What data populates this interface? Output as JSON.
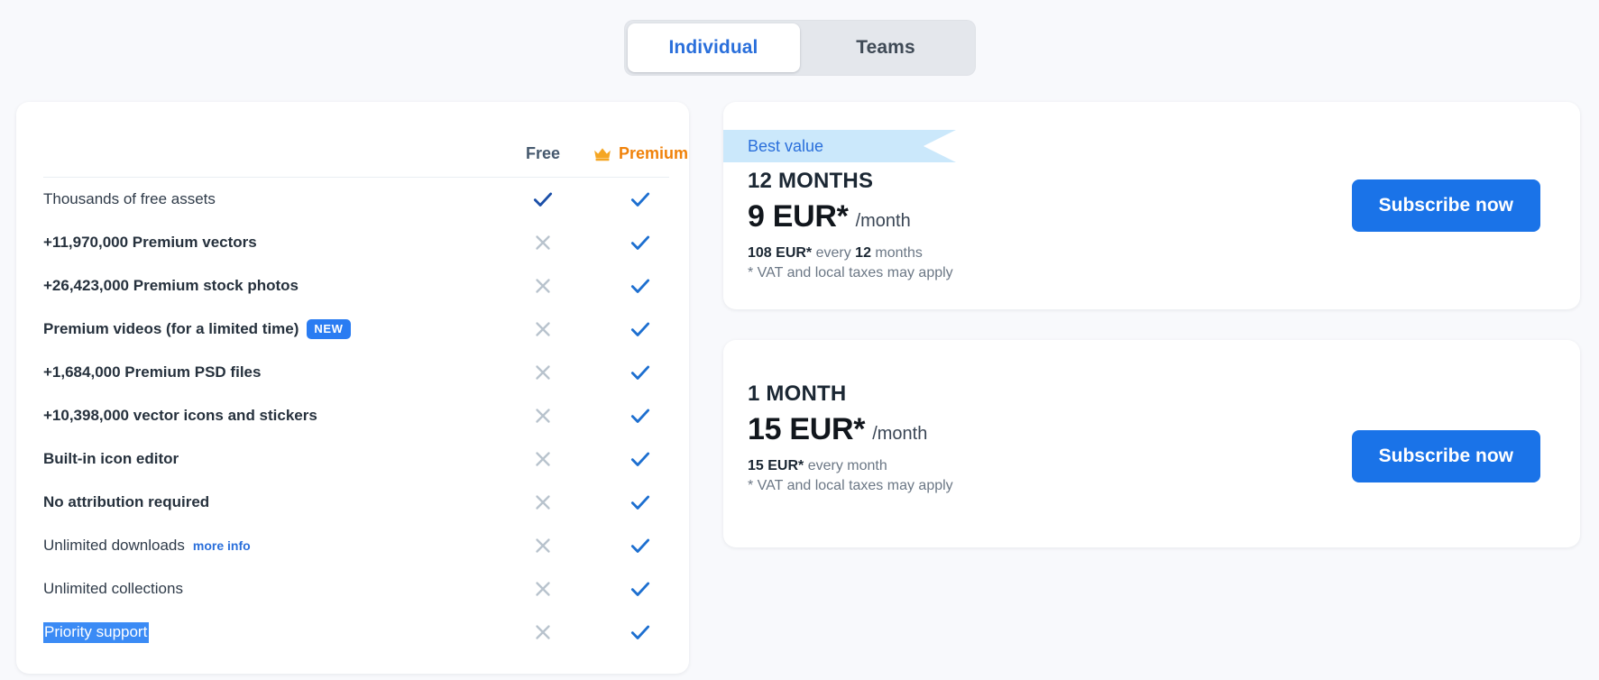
{
  "tabs": {
    "individual": "Individual",
    "teams": "Teams"
  },
  "features": {
    "columns": {
      "free": "Free",
      "premium": "Premium",
      "premium_icon": "crown-icon"
    },
    "rows": [
      {
        "label": "Thousands of free assets",
        "bold": false,
        "free": "check",
        "premium": "check"
      },
      {
        "label": "+11,970,000 Premium vectors",
        "bold": true,
        "free": "cross",
        "premium": "check"
      },
      {
        "label": "+26,423,000 Premium stock photos",
        "bold": true,
        "free": "cross",
        "premium": "check"
      },
      {
        "label": "Premium videos (for a limited time)",
        "bold": true,
        "badge": "NEW",
        "free": "cross",
        "premium": "check"
      },
      {
        "label": "+1,684,000 Premium PSD files",
        "bold": true,
        "free": "cross",
        "premium": "check"
      },
      {
        "label": "+10,398,000 vector icons and stickers",
        "bold": true,
        "free": "cross",
        "premium": "check"
      },
      {
        "label": "Built-in icon editor",
        "bold": true,
        "free": "cross",
        "premium": "check"
      },
      {
        "label": "No attribution required",
        "bold": true,
        "free": "cross",
        "premium": "check"
      },
      {
        "label": "Unlimited downloads",
        "bold": false,
        "link": "more info",
        "free": "cross",
        "premium": "check"
      },
      {
        "label": "Unlimited collections",
        "bold": false,
        "free": "cross",
        "premium": "check"
      },
      {
        "label": "Priority support",
        "bold": false,
        "selected": true,
        "free": "cross",
        "premium": "check"
      }
    ]
  },
  "plans": [
    {
      "ribbon": "Best value",
      "term": "12 MONTHS",
      "price": "9 EUR*",
      "per": "/month",
      "billing_amount": "108 EUR*",
      "billing_rest_pre": " every ",
      "billing_period": "12",
      "billing_rest_post": " months",
      "vat": "* VAT and local taxes may apply",
      "cta": "Subscribe now"
    },
    {
      "term": "1 MONTH",
      "price": "15 EUR*",
      "per": "/month",
      "billing_amount": "15 EUR*",
      "billing_rest_pre": " every month",
      "billing_period": "",
      "billing_rest_post": "",
      "vat": "* VAT and local taxes may apply",
      "cta": "Subscribe now"
    }
  ],
  "colors": {
    "accent_blue": "#1a73e8",
    "tab_active_text": "#2a6fdb",
    "premium_orange": "#f0820a",
    "ribbon_bg": "#cbe8fb",
    "cross_gray": "#b8c3cd",
    "selection_blue": "#3b8bf5",
    "page_bg": "#f8f9fc"
  }
}
